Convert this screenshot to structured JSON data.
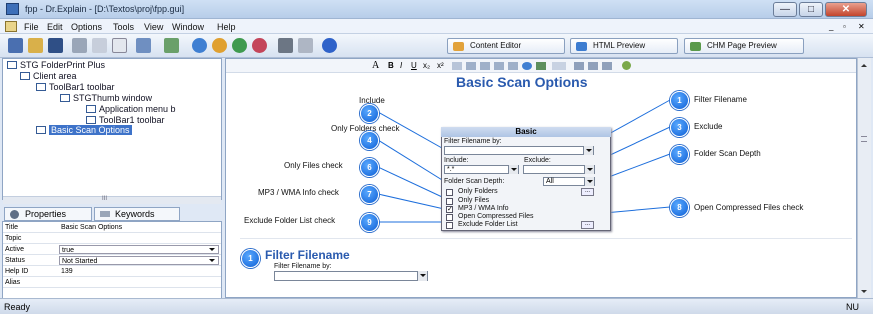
{
  "window": {
    "title": "fpp - Dr.Explain - [D:\\Textos\\proj\\fpp.gui]",
    "minimize": "—",
    "maximize": "□",
    "close": "✕"
  },
  "menubar": {
    "items": [
      "File",
      "Edit",
      "Options",
      "Tools",
      "View",
      "Window",
      "Help"
    ],
    "mdi_controls": [
      "_",
      "▫",
      "✕"
    ]
  },
  "toolbar": {
    "icons": [
      "save-all-icon",
      "open-icon",
      "save-icon",
      "cut-icon",
      "copy-icon",
      "paste-icon",
      "screen-icon",
      "capture-icon",
      "run-icon",
      "run-icon-2",
      "run-icon-3",
      "run-icon-4",
      "tools-icon",
      "print-icon",
      "help-icon"
    ],
    "tabs": [
      "Content Editor",
      "HTML Preview",
      "CHM Page Preview"
    ]
  },
  "tree": {
    "nodes": [
      {
        "label": "STG FolderPrint Plus",
        "level": 0
      },
      {
        "label": "Client area",
        "level": 1
      },
      {
        "label": "ToolBar1 toolbar",
        "level": 2
      },
      {
        "label": "STGThumb window",
        "level": 3
      },
      {
        "label": "Application menu b",
        "level": 4
      },
      {
        "label": "ToolBar1 toolbar",
        "level": 4
      },
      {
        "label": "Basic Scan Options",
        "level": 1,
        "selected": true
      }
    ],
    "scroll_grip": "III"
  },
  "properties": {
    "tabs": [
      "Properties",
      "Keywords"
    ],
    "rows": [
      {
        "label": "Title",
        "value": "Basic Scan Options",
        "dropdown": false
      },
      {
        "label": "Topic",
        "value": "",
        "dropdown": false
      },
      {
        "label": "Active",
        "value": "true",
        "dropdown": true
      },
      {
        "label": "Status",
        "value": "Not Started",
        "dropdown": true
      },
      {
        "label": "Help ID",
        "value": "139",
        "dropdown": false
      },
      {
        "label": "Alias",
        "value": "",
        "dropdown": false
      }
    ]
  },
  "format_toolbar": {
    "items": [
      "A",
      "B",
      "I",
      "U",
      "x₂",
      "x²"
    ]
  },
  "editor": {
    "page_title": "Basic Scan Options",
    "callouts_left": [
      {
        "num": "2",
        "label": "Include"
      },
      {
        "num": "4",
        "label": "Only Folders check"
      },
      {
        "num": "6",
        "label": "Only Files check"
      },
      {
        "num": "7",
        "label": "MP3 / WMA Info check"
      },
      {
        "num": "9",
        "label": "Exclude Folder List check"
      }
    ],
    "callouts_right": [
      {
        "num": "1",
        "label": "Filter Filename"
      },
      {
        "num": "3",
        "label": "Exclude"
      },
      {
        "num": "5",
        "label": "Folder Scan Depth"
      },
      {
        "num": "8",
        "label": "Open Compressed Files check"
      }
    ],
    "section": {
      "num": "1",
      "heading": "Filter Filename",
      "field_label": "Filter Filename by:"
    }
  },
  "dialog": {
    "title": "Basic",
    "filter_label": "Filter Filename by:",
    "include_label": "Include:",
    "include_value": "*.*",
    "exclude_label": "Exclude:",
    "depth_label": "Folder Scan Depth:",
    "depth_value": "All",
    "checks": [
      {
        "label": "Only Folders",
        "checked": false
      },
      {
        "label": "Only Files",
        "checked": false
      },
      {
        "label": "MP3 / WMA Info",
        "checked": true
      },
      {
        "label": "Open Compressed Files",
        "checked": false
      },
      {
        "label": "Exclude Folder List",
        "checked": false
      }
    ],
    "ellipsis": "..."
  },
  "statusbar": {
    "left": "Ready",
    "right": "NU"
  },
  "colors": {
    "accent": "#2a5aae",
    "callout": "#1e6fdc",
    "selection": "#3e73c9"
  }
}
